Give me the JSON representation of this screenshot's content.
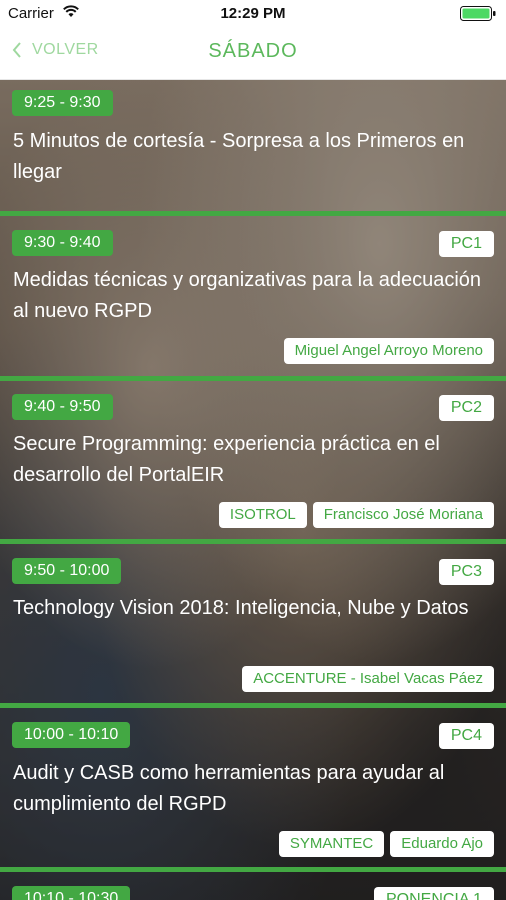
{
  "status_bar": {
    "carrier": "Carrier",
    "time": "12:29 PM"
  },
  "nav": {
    "back_label": "VOLVER",
    "title": "SÁBADO"
  },
  "colors": {
    "accent": "#43a843",
    "nav_title": "#5cb85c",
    "back": "#9fd89f"
  },
  "sessions": [
    {
      "time": "9:25 - 9:30",
      "room": "",
      "title": "5 Minutos de cortesía - Sorpresa a los Primeros en llegar",
      "speakers": []
    },
    {
      "time": "9:30 - 9:40",
      "room": "PC1",
      "title": "Medidas técnicas y organizativas para la adecuación al nuevo RGPD",
      "speakers": [
        "Miguel Angel Arroyo Moreno"
      ]
    },
    {
      "time": "9:40 - 9:50",
      "room": "PC2",
      "title": "Secure Programming: experiencia práctica en el desarrollo del PortalEIR",
      "speakers": [
        "ISOTROL",
        "Francisco José Moriana"
      ]
    },
    {
      "time": "9:50 - 10:00",
      "room": "PC3",
      "title": "Technology Vision 2018: Inteligencia, Nube y Datos",
      "speakers": [
        "ACCENTURE - Isabel Vacas Páez"
      ]
    },
    {
      "time": "10:00 - 10:10",
      "room": "PC4",
      "title": "Audit y CASB como herramientas para ayudar al cumplimiento del RGPD",
      "speakers": [
        "SYMANTEC",
        "Eduardo Ajo"
      ]
    },
    {
      "time": "10:10 - 10:30",
      "room": "PONENCIA 1",
      "title": "",
      "speakers": []
    }
  ]
}
